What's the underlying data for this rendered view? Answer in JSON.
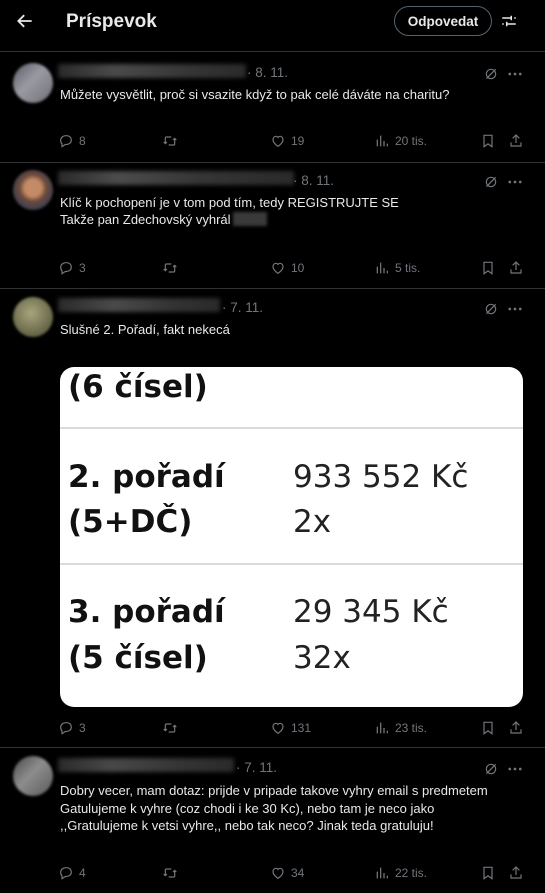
{
  "header": {
    "title": "Príspevok",
    "reply_label": "Odpovedat"
  },
  "posts": [
    {
      "date": "· 8. 11.",
      "text": "Můžete vysvětlit, proč si vsazite když to pak celé dáváte na charitu?",
      "replies": "8",
      "retweets": "",
      "likes": "19",
      "views": "20 tis."
    },
    {
      "date": "· 8. 11.",
      "text_line1": "Klíč k pochopení je v tom pod tím, tedy REGISTRUJTE SE",
      "text_line2": "Takže pan Zdechovský vyhrál",
      "replies": "3",
      "retweets": "",
      "likes": "10",
      "views": "5 tis."
    },
    {
      "date": "· 7. 11.",
      "text": "Slušné 2. Pořadí, fakt nekecá",
      "image": {
        "row0_label": "(6 čísel)",
        "row1_label_a": "2. pořadí",
        "row1_label_b": "(5+DČ)",
        "row1_value_a": "933 552 Kč",
        "row1_value_b": "2x",
        "row2_label_a": "3. pořadí",
        "row2_label_b": "(5 čísel)",
        "row2_value_a": "29 345 Kč",
        "row2_value_b": "32x"
      },
      "replies": "3",
      "retweets": "",
      "likes": "131",
      "views": "23 tis."
    },
    {
      "date": "· 7. 11.",
      "text_line1": "Dobry vecer, mam dotaz: prijde v pripade takove vyhry email s predmetem",
      "text_line2": "Gatulujeme k vyhre (coz chodi i ke 30 Kc), nebo tam je neco jako",
      "text_line3": ",,Gratulujeme k vetsi vyhre,, nebo tak neco? Jinak teda gratuluju!",
      "replies": "4",
      "retweets": "",
      "likes": "34",
      "views": "22 tis."
    }
  ],
  "colors": {
    "background": "#000000",
    "text": "#e7e9ea",
    "muted": "#71767b",
    "divider": "#2f3336"
  }
}
